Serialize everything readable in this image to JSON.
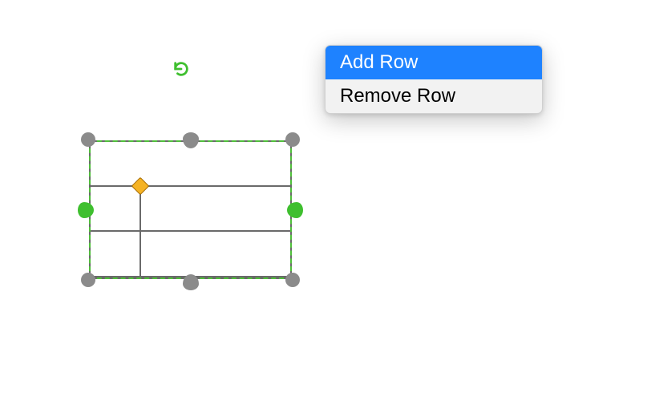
{
  "colors": {
    "selection_green": "#3fbf2f",
    "handle_gray": "#8b8b8b",
    "adjust_yellow": "#f5b325",
    "menu_highlight": "#1e82ff"
  },
  "context_menu": {
    "items": [
      {
        "label": "Add Row",
        "selected": true
      },
      {
        "label": "Remove Row",
        "selected": false
      }
    ]
  },
  "icons": {
    "rotate": "rotate-icon"
  }
}
